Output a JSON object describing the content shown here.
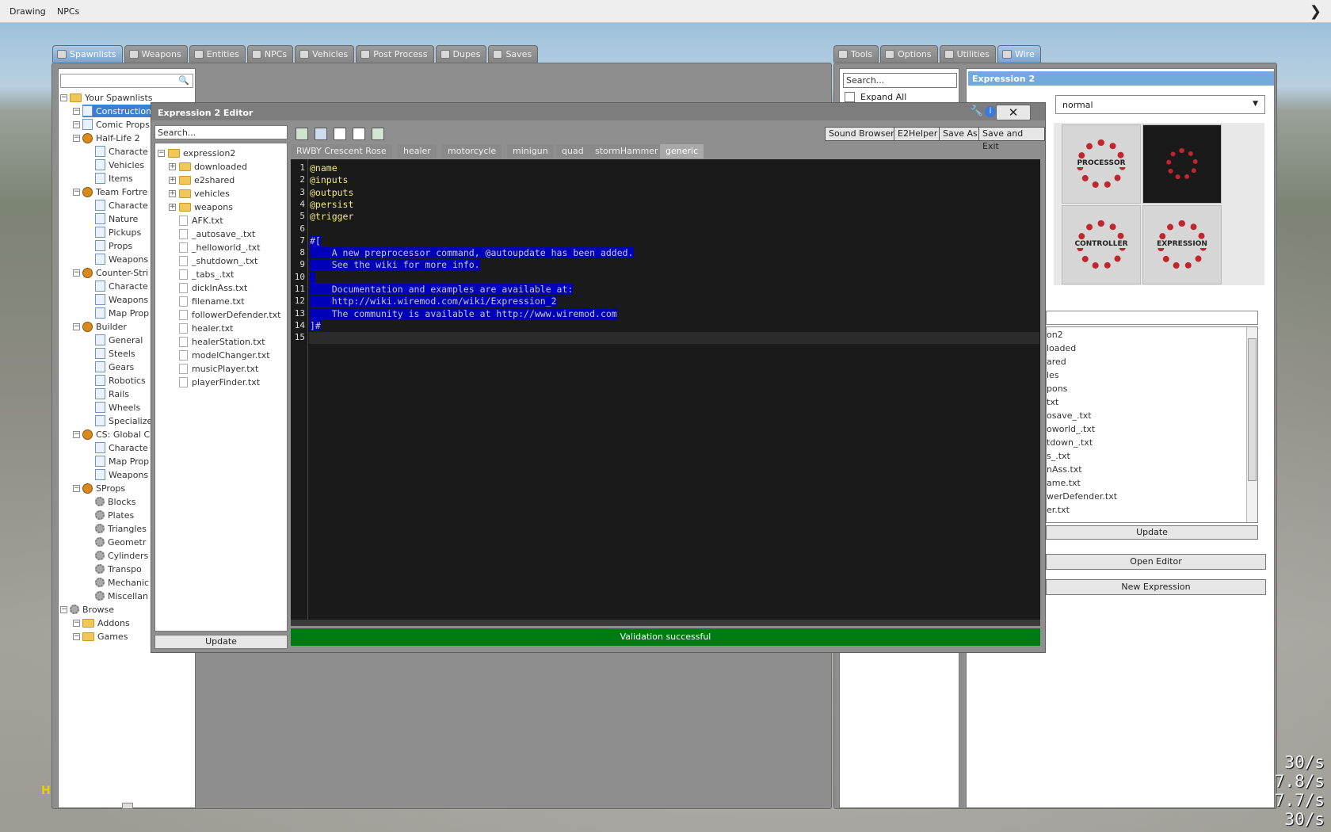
{
  "menubar": {
    "items": [
      "Drawing",
      "NPCs"
    ]
  },
  "spawn_tabs": [
    "Spawnlists",
    "Weapons",
    "Entities",
    "NPCs",
    "Vehicles",
    "Post Process",
    "Dupes",
    "Saves"
  ],
  "tool_tabs": [
    "Tools",
    "Options",
    "Utilities",
    "Wire"
  ],
  "spawnlist_tree": [
    {
      "label": "Your Spawnlists",
      "level": 0,
      "icon": "folder"
    },
    {
      "label": "Construction",
      "level": 1,
      "icon": "doc",
      "selected": true
    },
    {
      "label": "Comic Props",
      "level": 1,
      "icon": "doc"
    },
    {
      "label": "Half-Life 2",
      "level": 1,
      "icon": "game"
    },
    {
      "label": "Characte",
      "level": 2,
      "icon": "doc"
    },
    {
      "label": "Vehicles",
      "level": 2,
      "icon": "doc"
    },
    {
      "label": "Items",
      "level": 2,
      "icon": "doc"
    },
    {
      "label": "Team Fortre",
      "level": 1,
      "icon": "game"
    },
    {
      "label": "Characte",
      "level": 2,
      "icon": "doc"
    },
    {
      "label": "Nature",
      "level": 2,
      "icon": "doc"
    },
    {
      "label": "Pickups",
      "level": 2,
      "icon": "doc"
    },
    {
      "label": "Props",
      "level": 2,
      "icon": "doc"
    },
    {
      "label": "Weapons",
      "level": 2,
      "icon": "doc"
    },
    {
      "label": "Counter-Stri",
      "level": 1,
      "icon": "game"
    },
    {
      "label": "Characte",
      "level": 2,
      "icon": "doc"
    },
    {
      "label": "Weapons",
      "level": 2,
      "icon": "doc"
    },
    {
      "label": "Map Prop",
      "level": 2,
      "icon": "doc"
    },
    {
      "label": "Builder",
      "level": 1,
      "icon": "game"
    },
    {
      "label": "General",
      "level": 2,
      "icon": "doc"
    },
    {
      "label": "Steels",
      "level": 2,
      "icon": "doc"
    },
    {
      "label": "Gears",
      "level": 2,
      "icon": "doc"
    },
    {
      "label": "Robotics",
      "level": 2,
      "icon": "doc"
    },
    {
      "label": "Rails",
      "level": 2,
      "icon": "doc"
    },
    {
      "label": "Wheels",
      "level": 2,
      "icon": "doc"
    },
    {
      "label": "Specialize",
      "level": 2,
      "icon": "doc"
    },
    {
      "label": "CS: Global C",
      "level": 1,
      "icon": "game"
    },
    {
      "label": "Characte",
      "level": 2,
      "icon": "doc"
    },
    {
      "label": "Map Prop",
      "level": 2,
      "icon": "doc"
    },
    {
      "label": "Weapons",
      "level": 2,
      "icon": "doc"
    },
    {
      "label": "SProps",
      "level": 1,
      "icon": "game"
    },
    {
      "label": "Blocks",
      "level": 2,
      "icon": "gear"
    },
    {
      "label": "Plates",
      "level": 2,
      "icon": "gear"
    },
    {
      "label": "Triangles",
      "level": 2,
      "icon": "gear"
    },
    {
      "label": "Geometr",
      "level": 2,
      "icon": "gear"
    },
    {
      "label": "Cylinders",
      "level": 2,
      "icon": "gear"
    },
    {
      "label": "Transpo",
      "level": 2,
      "icon": "gear"
    },
    {
      "label": "Mechanic",
      "level": 2,
      "icon": "gear"
    },
    {
      "label": "Miscellan",
      "level": 2,
      "icon": "gear"
    },
    {
      "label": "Browse",
      "level": 0,
      "icon": "gear"
    },
    {
      "label": "Addons",
      "level": 1,
      "icon": "folder"
    },
    {
      "label": "Games",
      "level": 1,
      "icon": "folder"
    }
  ],
  "editor": {
    "title": "Expression 2 Editor",
    "close_glyph": "✕",
    "buttons": [
      "Sound Browser",
      "E2Helper",
      "Save As",
      "Save and Exit"
    ],
    "search_placeholder": "Search...",
    "file_tree": [
      {
        "label": "expression2",
        "type": "folder",
        "level": 0
      },
      {
        "label": "downloaded",
        "type": "folder",
        "level": 1
      },
      {
        "label": "e2shared",
        "type": "folder",
        "level": 1
      },
      {
        "label": "vehicles",
        "type": "folder",
        "level": 1
      },
      {
        "label": "weapons",
        "type": "folder",
        "level": 1
      },
      {
        "label": "AFK.txt",
        "type": "file",
        "level": 1
      },
      {
        "label": "_autosave_.txt",
        "type": "file",
        "level": 1
      },
      {
        "label": "_helloworld_.txt",
        "type": "file",
        "level": 1
      },
      {
        "label": "_shutdown_.txt",
        "type": "file",
        "level": 1
      },
      {
        "label": "_tabs_.txt",
        "type": "file",
        "level": 1
      },
      {
        "label": "dickInAss.txt",
        "type": "file",
        "level": 1
      },
      {
        "label": "filename.txt",
        "type": "file",
        "level": 1
      },
      {
        "label": "followerDefender.txt",
        "type": "file",
        "level": 1
      },
      {
        "label": "healer.txt",
        "type": "file",
        "level": 1
      },
      {
        "label": "healerStation.txt",
        "type": "file",
        "level": 1
      },
      {
        "label": "modelChanger.txt",
        "type": "file",
        "level": 1
      },
      {
        "label": "musicPlayer.txt",
        "type": "file",
        "level": 1
      },
      {
        "label": "playerFinder.txt",
        "type": "file",
        "level": 1
      }
    ],
    "update_label": "Update",
    "code_tabs": [
      "RWBY Crescent Rose",
      "healer",
      "motorcycle",
      "minigun",
      "quad",
      "stormHammer",
      "generic"
    ],
    "active_tab": "generic",
    "code_lines": [
      {
        "n": "1",
        "text": "@name",
        "kind": "kw"
      },
      {
        "n": "2",
        "text": "@inputs",
        "kind": "kw"
      },
      {
        "n": "3",
        "text": "@outputs",
        "kind": "kw"
      },
      {
        "n": "4",
        "text": "@persist",
        "kind": "kw"
      },
      {
        "n": "5",
        "text": "@trigger",
        "kind": "kw"
      },
      {
        "n": "6",
        "text": "",
        "kind": "plain"
      },
      {
        "n": "7",
        "text": "#[",
        "kind": "sel"
      },
      {
        "n": "8",
        "text": "    A new preprocessor command, @autoupdate has been added.",
        "kind": "sel"
      },
      {
        "n": "9",
        "text": "    See the wiki for more info.",
        "kind": "sel"
      },
      {
        "n": "10",
        "text": " ",
        "kind": "sel"
      },
      {
        "n": "11",
        "text": "    Documentation and examples are available at:",
        "kind": "sel"
      },
      {
        "n": "12",
        "text": "    http://wiki.wiremod.com/wiki/Expression_2",
        "kind": "sel"
      },
      {
        "n": "13",
        "text": "    The community is available at http://www.wiremod.com",
        "kind": "sel"
      },
      {
        "n": "14",
        "text": "]#",
        "kind": "sel"
      },
      {
        "n": "15",
        "text": "",
        "kind": "plain"
      }
    ],
    "status": "Validation successful"
  },
  "right_panel": {
    "search_placeholder": "Search...",
    "expand_all": "Expand All",
    "header": "Expression 2",
    "dropdown_value": "normal",
    "tiles": [
      "PROCESSOR",
      "",
      "CONTROLLER",
      "EXPRESSION"
    ],
    "list_items": [
      "on2",
      "loaded",
      "ared",
      "les",
      "pons",
      "txt",
      "osave_.txt",
      "oworld_.txt",
      "tdown_.txt",
      "s_.txt",
      "nAss.txt",
      "ame.txt",
      "werDefender.txt",
      "er.txt"
    ],
    "update_label": "Update",
    "open_editor": "Open Editor",
    "new_expression": "New Expression"
  },
  "fps": [
    "30/s",
    "7.8/s",
    "7.7/s",
    "30/s"
  ],
  "colors": {
    "selection": "#0000b8",
    "status_ok": "#007a12",
    "active_tab": "#7aa4cf"
  }
}
